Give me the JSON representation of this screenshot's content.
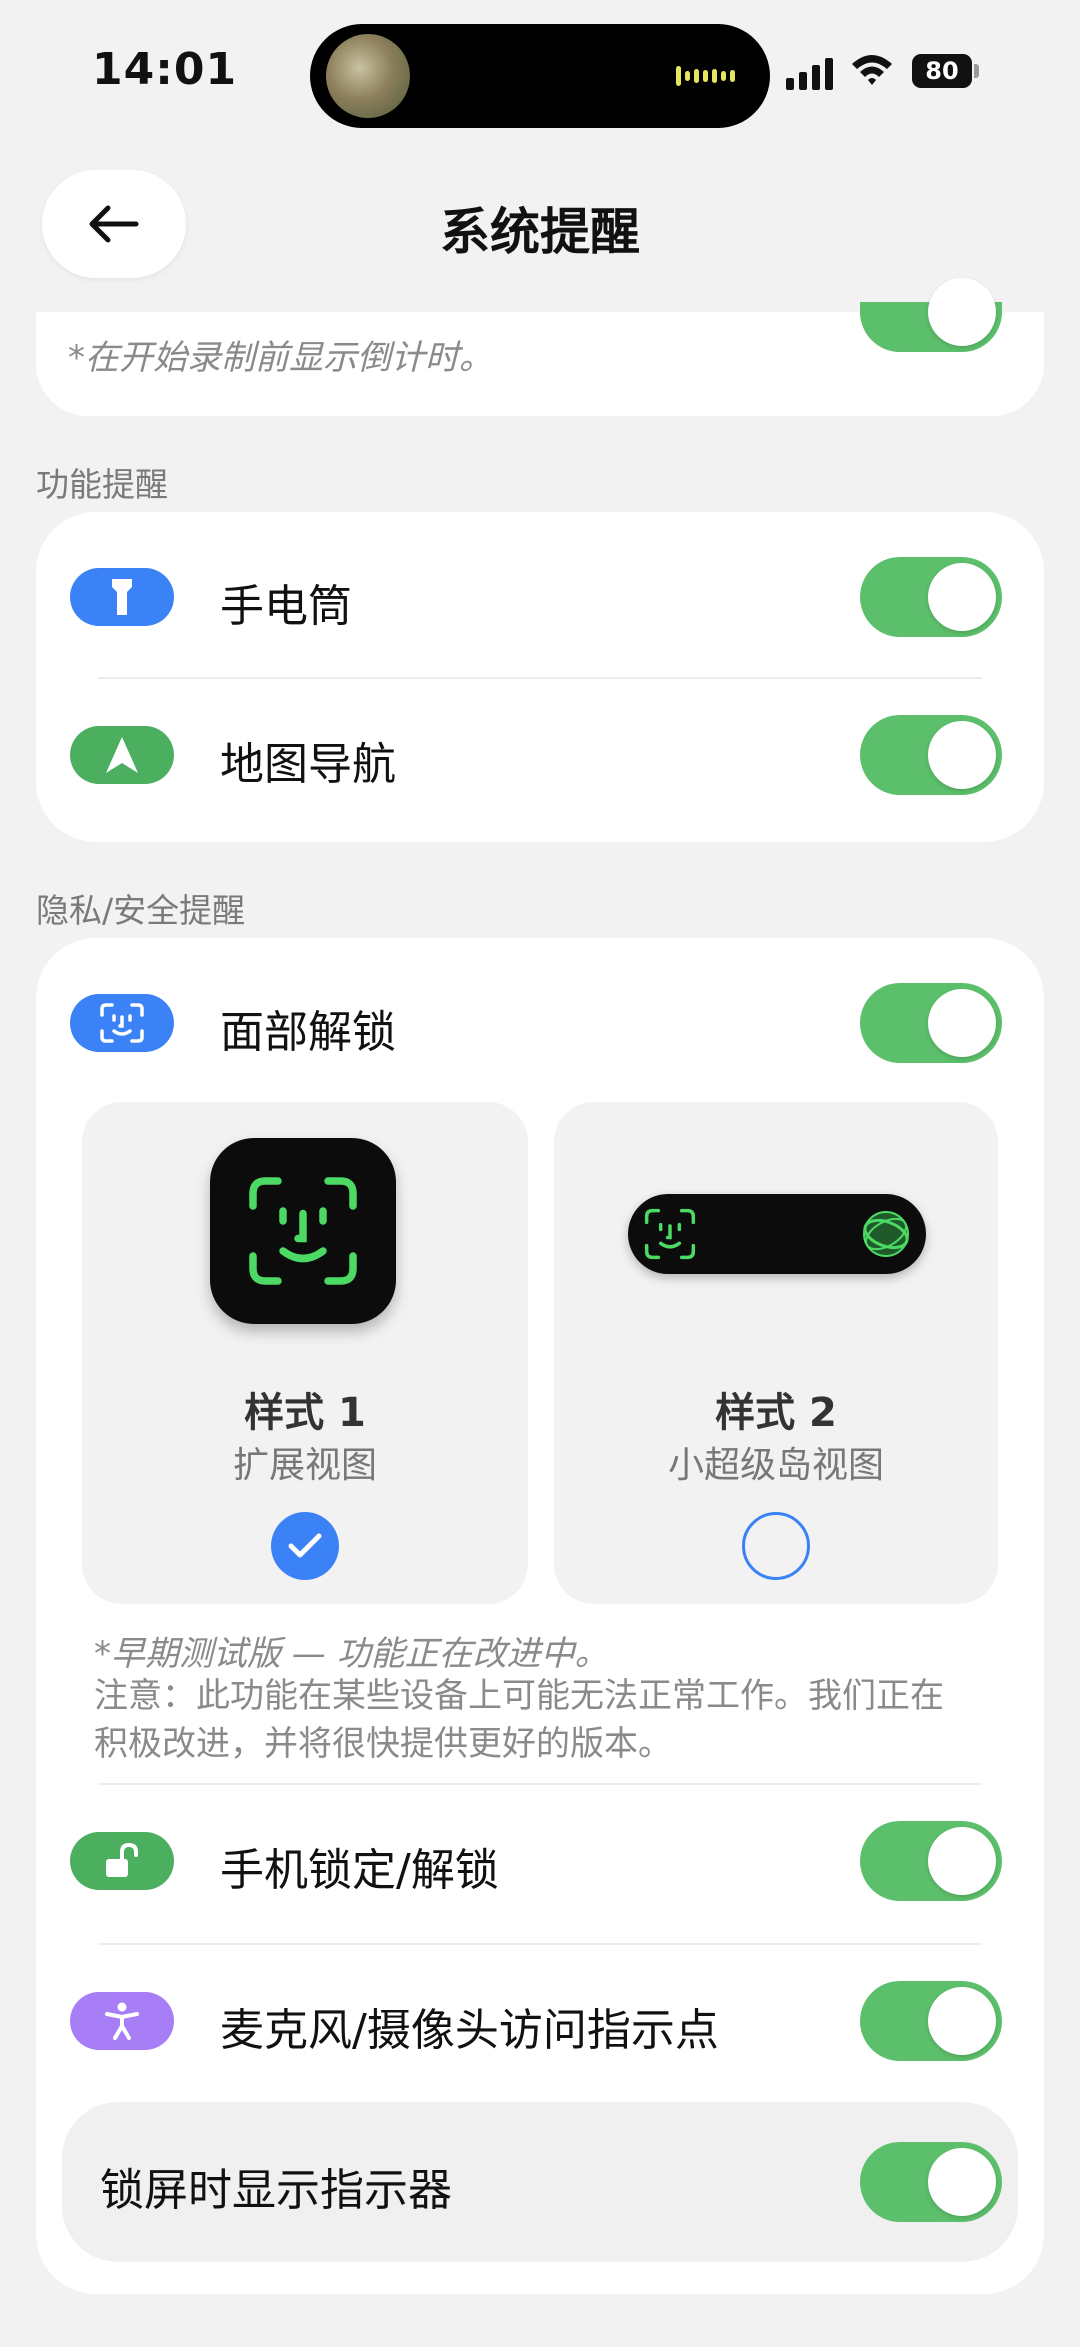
{
  "status_bar": {
    "time": "14:01",
    "battery": "80"
  },
  "header": {
    "title": "系统提醒"
  },
  "top_card": {
    "subtitle": "*在开始录制前显示倒计时。"
  },
  "feature_section": {
    "label": "功能提醒",
    "items": [
      {
        "label": "手电筒",
        "icon": "flashlight-icon",
        "icon_color": "#3b82f6",
        "enabled": true
      },
      {
        "label": "地图导航",
        "icon": "navigation-arrow-icon",
        "icon_color": "#4caf5f",
        "enabled": true
      }
    ]
  },
  "privacy_section": {
    "label": "隐私/安全提醒",
    "face_unlock": {
      "label": "面部解锁",
      "icon": "face-id-icon",
      "icon_color": "#3b82f6",
      "enabled": true
    },
    "styles": [
      {
        "title": "样式 1",
        "subtitle": "扩展视图",
        "selected": true
      },
      {
        "title": "样式 2",
        "subtitle": "小超级岛视图",
        "selected": false
      }
    ],
    "note_title": "*早期测试版 — 功能正在改进中。",
    "note_lines": [
      "注意：此功能在某些设备上可能无法正常工作。我们正在",
      "积极改进，并将很快提供更好的版本。"
    ],
    "lock_item": {
      "label": "手机锁定/解锁",
      "icon": "unlock-icon",
      "icon_color": "#4caf5f",
      "enabled": true
    },
    "mic_item": {
      "label": "麦克风/摄像头访问指示点",
      "icon": "accessibility-icon",
      "icon_color": "#a77ef5",
      "enabled": true
    },
    "lockscreen_item": {
      "label": "锁屏时显示指示器",
      "enabled": true
    }
  },
  "colors": {
    "toggle_on": "#5cbf6b",
    "accent_blue": "#3b82f6",
    "background": "#f2f2f2"
  }
}
